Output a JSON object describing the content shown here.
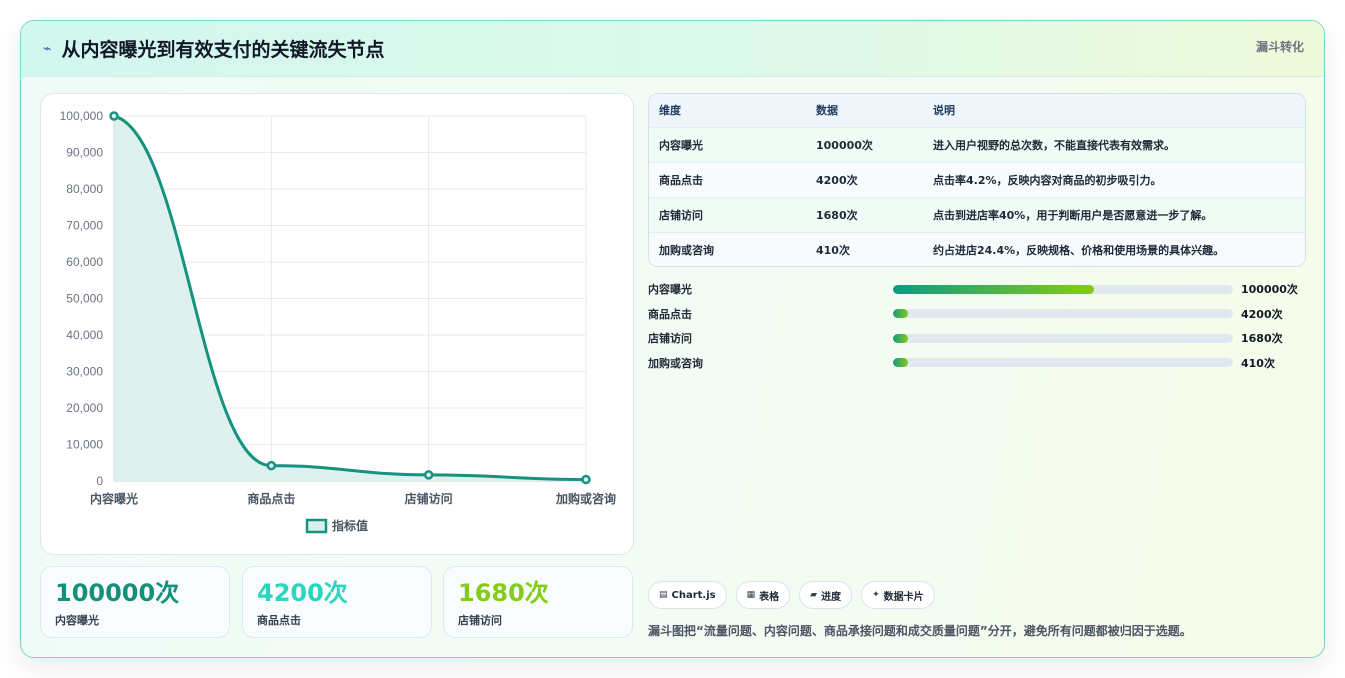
{
  "header": {
    "title": "从内容曝光到有效支付的关键流失节点",
    "tag": "漏斗转化",
    "icon": "bolt-icon"
  },
  "chart_data": {
    "type": "area",
    "categories": [
      "内容曝光",
      "商品点击",
      "店铺访问",
      "加购或咨询"
    ],
    "series": [
      {
        "name": "指标值",
        "values": [
          100000,
          4200,
          1680,
          410
        ]
      }
    ],
    "ylim": [
      0,
      100000
    ],
    "yticks": [
      "100,000",
      "90,000",
      "80,000",
      "70,000",
      "60,000",
      "50,000",
      "40,000",
      "30,000",
      "20,000",
      "10,000",
      "0"
    ],
    "legend_position": "bottom",
    "grid": true,
    "colors": {
      "line": "#16937f",
      "fill": "#dcefec"
    }
  },
  "stats": [
    {
      "value": "100000次",
      "label": "内容曝光",
      "color": "#14907c"
    },
    {
      "value": "4200次",
      "label": "商品点击",
      "color": "#2dd4bf"
    },
    {
      "value": "1680次",
      "label": "店铺访问",
      "color": "#84cc16"
    }
  ],
  "table": {
    "headers": [
      "维度",
      "数据",
      "说明"
    ],
    "rows": [
      [
        "内容曝光",
        "100000次",
        "进入用户视野的总次数，不能直接代表有效需求。"
      ],
      [
        "商品点击",
        "4200次",
        "点击率4.2%，反映内容对商品的初步吸引力。"
      ],
      [
        "店铺访问",
        "1680次",
        "点击到进店率40%，用于判断用户是否愿意进一步了解。"
      ],
      [
        "加购或咨询",
        "410次",
        "约占进店24.4%，反映规格、价格和使用场景的具体兴趣。"
      ]
    ]
  },
  "bars": [
    {
      "label": "内容曝光",
      "value": "100000次",
      "fraction": 0.59
    },
    {
      "label": "商品点击",
      "value": "4200次",
      "fraction": 0.045
    },
    {
      "label": "店铺访问",
      "value": "1680次",
      "fraction": 0.045
    },
    {
      "label": "加购或咨询",
      "value": "410次",
      "fraction": 0.045
    }
  ],
  "chips": [
    {
      "icon": "chart-icon",
      "glyph": "▤",
      "label": "Chart.js"
    },
    {
      "icon": "table-icon",
      "glyph": "▦",
      "label": "表格"
    },
    {
      "icon": "progress-icon",
      "glyph": "▰",
      "label": "进度"
    },
    {
      "icon": "sparkle-icon",
      "glyph": "✦",
      "label": "数据卡片"
    }
  ],
  "note": "漏斗图把“流量问题、内容问题、商品承接问题和成交质量问题”分开，避免所有问题都被归因于选题。"
}
